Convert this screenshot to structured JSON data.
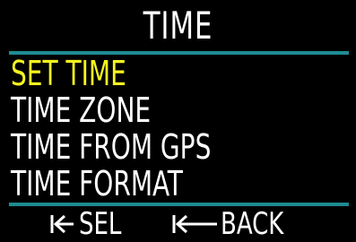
{
  "header": {
    "title": "TIME"
  },
  "menu": {
    "items": [
      {
        "label": "SET TIME",
        "selected": true
      },
      {
        "label": "TIME ZONE",
        "selected": false
      },
      {
        "label": "TIME FROM GPS",
        "selected": false
      },
      {
        "label": "TIME FORMAT",
        "selected": false
      }
    ]
  },
  "footer": {
    "select_label": "SEL",
    "select_icon": "arrow-to-bar-left-short-icon",
    "back_label": "BACK",
    "back_icon": "arrow-to-bar-left-long-icon"
  },
  "colors": {
    "background": "#000000",
    "text": "#ffffff",
    "selected": "#f6f51f",
    "divider": "#1f8a92"
  }
}
